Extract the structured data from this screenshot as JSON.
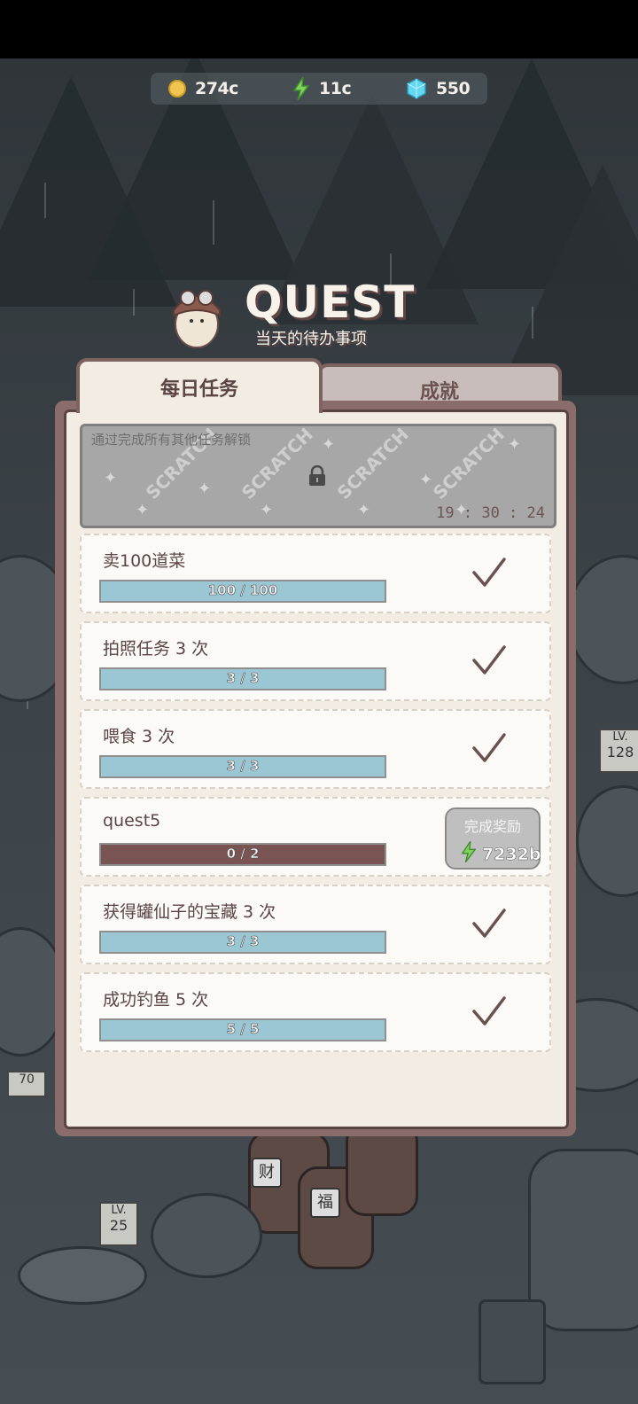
{
  "currencies": {
    "coins": "274c",
    "energy": "11c",
    "gems": "550"
  },
  "header": {
    "title": "QUEST",
    "subtitle": "当天的待办事项"
  },
  "tabs": [
    {
      "label": "每日任务",
      "active": true
    },
    {
      "label": "成就",
      "active": false
    }
  ],
  "locked_quest": {
    "hint": "通过完成所有其他任务解锁",
    "overlay_text": "SCRATCH",
    "timer": "19 : 30 : 24"
  },
  "quests": [
    {
      "name": "卖100道菜",
      "progress": "100 / 100",
      "fraction": 1.0,
      "state": "done"
    },
    {
      "name": "拍照任务 3 次",
      "progress": "3 / 3",
      "fraction": 1.0,
      "state": "done"
    },
    {
      "name": "喂食 3 次",
      "progress": "3 / 3",
      "fraction": 1.0,
      "state": "done"
    },
    {
      "name": "quest5",
      "progress": "0 / 2",
      "fraction": 0.0,
      "state": "incomplete",
      "claim_label": "完成奖励",
      "reward": "7232b"
    },
    {
      "name": "获得罐仙子的宝藏 3 次",
      "progress": "3 / 3",
      "fraction": 1.0,
      "state": "done"
    },
    {
      "name": "成功钓鱼 5 次",
      "progress": "5 / 5",
      "fraction": 1.0,
      "state": "done"
    }
  ],
  "background_signs": {
    "level_left": "LV.",
    "level_left_value": "25",
    "level_right": "LV.",
    "level_right_value": "128",
    "post_value": "70",
    "barrel_char_1": "福",
    "barrel_char_2": "财"
  },
  "colors": {
    "panel_border": "#8a6d6a",
    "panel_bg": "#f2ece2",
    "bar_complete": "#9bc6d3",
    "bar_incomplete": "#7a5452",
    "text_brown": "#5a4544"
  }
}
